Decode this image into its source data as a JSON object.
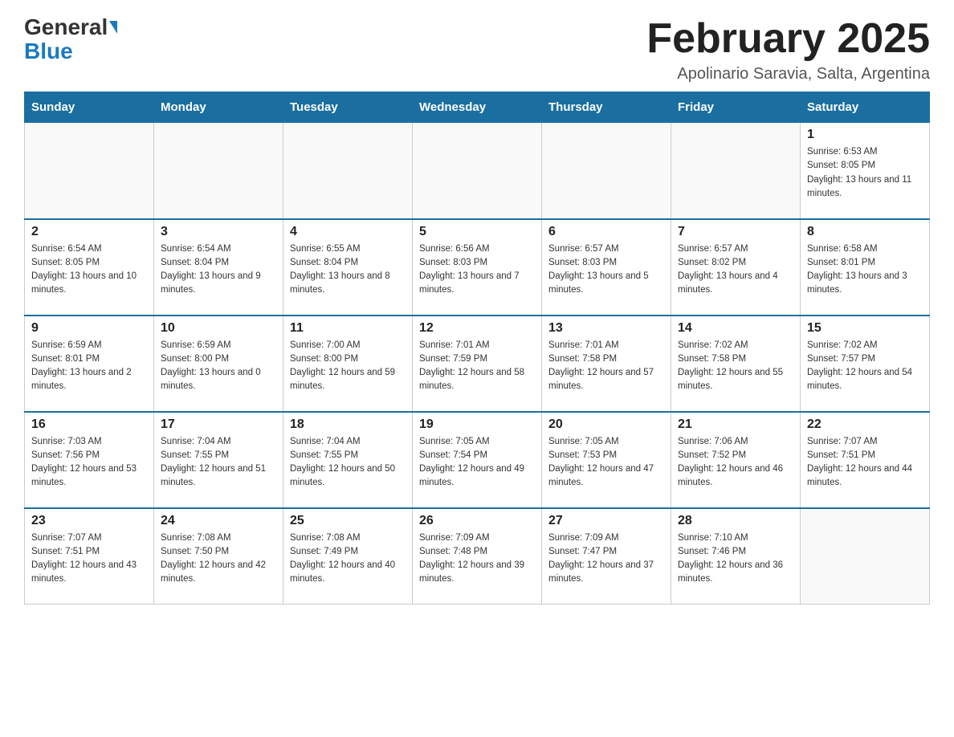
{
  "header": {
    "logo": {
      "part1": "General",
      "part2": "Blue"
    },
    "title": "February 2025",
    "location": "Apolinario Saravia, Salta, Argentina"
  },
  "days_of_week": [
    "Sunday",
    "Monday",
    "Tuesday",
    "Wednesday",
    "Thursday",
    "Friday",
    "Saturday"
  ],
  "weeks": [
    [
      {
        "day": "",
        "sunrise": "",
        "sunset": "",
        "daylight": ""
      },
      {
        "day": "",
        "sunrise": "",
        "sunset": "",
        "daylight": ""
      },
      {
        "day": "",
        "sunrise": "",
        "sunset": "",
        "daylight": ""
      },
      {
        "day": "",
        "sunrise": "",
        "sunset": "",
        "daylight": ""
      },
      {
        "day": "",
        "sunrise": "",
        "sunset": "",
        "daylight": ""
      },
      {
        "day": "",
        "sunrise": "",
        "sunset": "",
        "daylight": ""
      },
      {
        "day": "1",
        "sunrise": "Sunrise: 6:53 AM",
        "sunset": "Sunset: 8:05 PM",
        "daylight": "Daylight: 13 hours and 11 minutes."
      }
    ],
    [
      {
        "day": "2",
        "sunrise": "Sunrise: 6:54 AM",
        "sunset": "Sunset: 8:05 PM",
        "daylight": "Daylight: 13 hours and 10 minutes."
      },
      {
        "day": "3",
        "sunrise": "Sunrise: 6:54 AM",
        "sunset": "Sunset: 8:04 PM",
        "daylight": "Daylight: 13 hours and 9 minutes."
      },
      {
        "day": "4",
        "sunrise": "Sunrise: 6:55 AM",
        "sunset": "Sunset: 8:04 PM",
        "daylight": "Daylight: 13 hours and 8 minutes."
      },
      {
        "day": "5",
        "sunrise": "Sunrise: 6:56 AM",
        "sunset": "Sunset: 8:03 PM",
        "daylight": "Daylight: 13 hours and 7 minutes."
      },
      {
        "day": "6",
        "sunrise": "Sunrise: 6:57 AM",
        "sunset": "Sunset: 8:03 PM",
        "daylight": "Daylight: 13 hours and 5 minutes."
      },
      {
        "day": "7",
        "sunrise": "Sunrise: 6:57 AM",
        "sunset": "Sunset: 8:02 PM",
        "daylight": "Daylight: 13 hours and 4 minutes."
      },
      {
        "day": "8",
        "sunrise": "Sunrise: 6:58 AM",
        "sunset": "Sunset: 8:01 PM",
        "daylight": "Daylight: 13 hours and 3 minutes."
      }
    ],
    [
      {
        "day": "9",
        "sunrise": "Sunrise: 6:59 AM",
        "sunset": "Sunset: 8:01 PM",
        "daylight": "Daylight: 13 hours and 2 minutes."
      },
      {
        "day": "10",
        "sunrise": "Sunrise: 6:59 AM",
        "sunset": "Sunset: 8:00 PM",
        "daylight": "Daylight: 13 hours and 0 minutes."
      },
      {
        "day": "11",
        "sunrise": "Sunrise: 7:00 AM",
        "sunset": "Sunset: 8:00 PM",
        "daylight": "Daylight: 12 hours and 59 minutes."
      },
      {
        "day": "12",
        "sunrise": "Sunrise: 7:01 AM",
        "sunset": "Sunset: 7:59 PM",
        "daylight": "Daylight: 12 hours and 58 minutes."
      },
      {
        "day": "13",
        "sunrise": "Sunrise: 7:01 AM",
        "sunset": "Sunset: 7:58 PM",
        "daylight": "Daylight: 12 hours and 57 minutes."
      },
      {
        "day": "14",
        "sunrise": "Sunrise: 7:02 AM",
        "sunset": "Sunset: 7:58 PM",
        "daylight": "Daylight: 12 hours and 55 minutes."
      },
      {
        "day": "15",
        "sunrise": "Sunrise: 7:02 AM",
        "sunset": "Sunset: 7:57 PM",
        "daylight": "Daylight: 12 hours and 54 minutes."
      }
    ],
    [
      {
        "day": "16",
        "sunrise": "Sunrise: 7:03 AM",
        "sunset": "Sunset: 7:56 PM",
        "daylight": "Daylight: 12 hours and 53 minutes."
      },
      {
        "day": "17",
        "sunrise": "Sunrise: 7:04 AM",
        "sunset": "Sunset: 7:55 PM",
        "daylight": "Daylight: 12 hours and 51 minutes."
      },
      {
        "day": "18",
        "sunrise": "Sunrise: 7:04 AM",
        "sunset": "Sunset: 7:55 PM",
        "daylight": "Daylight: 12 hours and 50 minutes."
      },
      {
        "day": "19",
        "sunrise": "Sunrise: 7:05 AM",
        "sunset": "Sunset: 7:54 PM",
        "daylight": "Daylight: 12 hours and 49 minutes."
      },
      {
        "day": "20",
        "sunrise": "Sunrise: 7:05 AM",
        "sunset": "Sunset: 7:53 PM",
        "daylight": "Daylight: 12 hours and 47 minutes."
      },
      {
        "day": "21",
        "sunrise": "Sunrise: 7:06 AM",
        "sunset": "Sunset: 7:52 PM",
        "daylight": "Daylight: 12 hours and 46 minutes."
      },
      {
        "day": "22",
        "sunrise": "Sunrise: 7:07 AM",
        "sunset": "Sunset: 7:51 PM",
        "daylight": "Daylight: 12 hours and 44 minutes."
      }
    ],
    [
      {
        "day": "23",
        "sunrise": "Sunrise: 7:07 AM",
        "sunset": "Sunset: 7:51 PM",
        "daylight": "Daylight: 12 hours and 43 minutes."
      },
      {
        "day": "24",
        "sunrise": "Sunrise: 7:08 AM",
        "sunset": "Sunset: 7:50 PM",
        "daylight": "Daylight: 12 hours and 42 minutes."
      },
      {
        "day": "25",
        "sunrise": "Sunrise: 7:08 AM",
        "sunset": "Sunset: 7:49 PM",
        "daylight": "Daylight: 12 hours and 40 minutes."
      },
      {
        "day": "26",
        "sunrise": "Sunrise: 7:09 AM",
        "sunset": "Sunset: 7:48 PM",
        "daylight": "Daylight: 12 hours and 39 minutes."
      },
      {
        "day": "27",
        "sunrise": "Sunrise: 7:09 AM",
        "sunset": "Sunset: 7:47 PM",
        "daylight": "Daylight: 12 hours and 37 minutes."
      },
      {
        "day": "28",
        "sunrise": "Sunrise: 7:10 AM",
        "sunset": "Sunset: 7:46 PM",
        "daylight": "Daylight: 12 hours and 36 minutes."
      },
      {
        "day": "",
        "sunrise": "",
        "sunset": "",
        "daylight": ""
      }
    ]
  ]
}
